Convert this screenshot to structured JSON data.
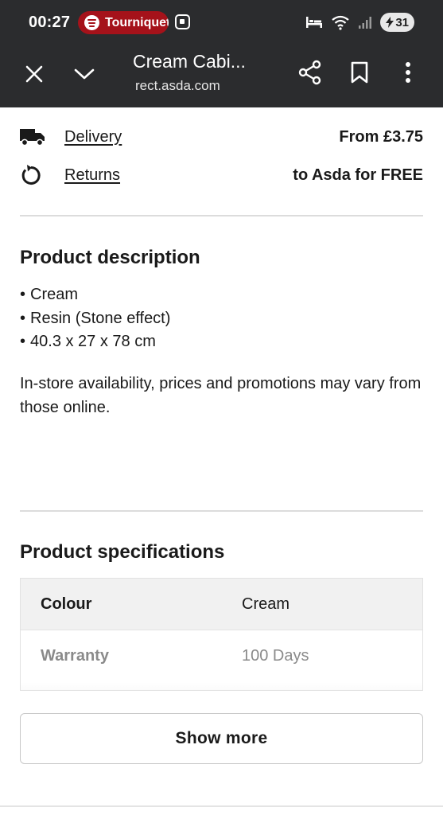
{
  "status_bar": {
    "time": "00:27",
    "media_app": "Tourniquet",
    "battery": "31"
  },
  "browser": {
    "page_title": "Cream Cabi...",
    "url": "rect.asda.com"
  },
  "shipping": {
    "delivery_label": "Delivery",
    "delivery_value": "From £3.75",
    "returns_label": "Returns",
    "returns_value": "to Asda for FREE"
  },
  "description": {
    "heading": "Product description",
    "bullets": [
      "Cream",
      "Resin (Stone effect)",
      "40.3 x 27 x 78 cm"
    ],
    "disclaimer": "In-store availability, prices and promotions may vary from those online."
  },
  "specifications": {
    "heading": "Product specifications",
    "rows": [
      {
        "key": "Colour",
        "value": "Cream"
      },
      {
        "key": "Warranty",
        "value": "100 Days"
      }
    ],
    "show_more_label": "Show more"
  },
  "colors": {
    "chrome_bg": "#2b2c2e",
    "spotify_pill": "#a5121a",
    "divider": "#dcdcdc"
  }
}
